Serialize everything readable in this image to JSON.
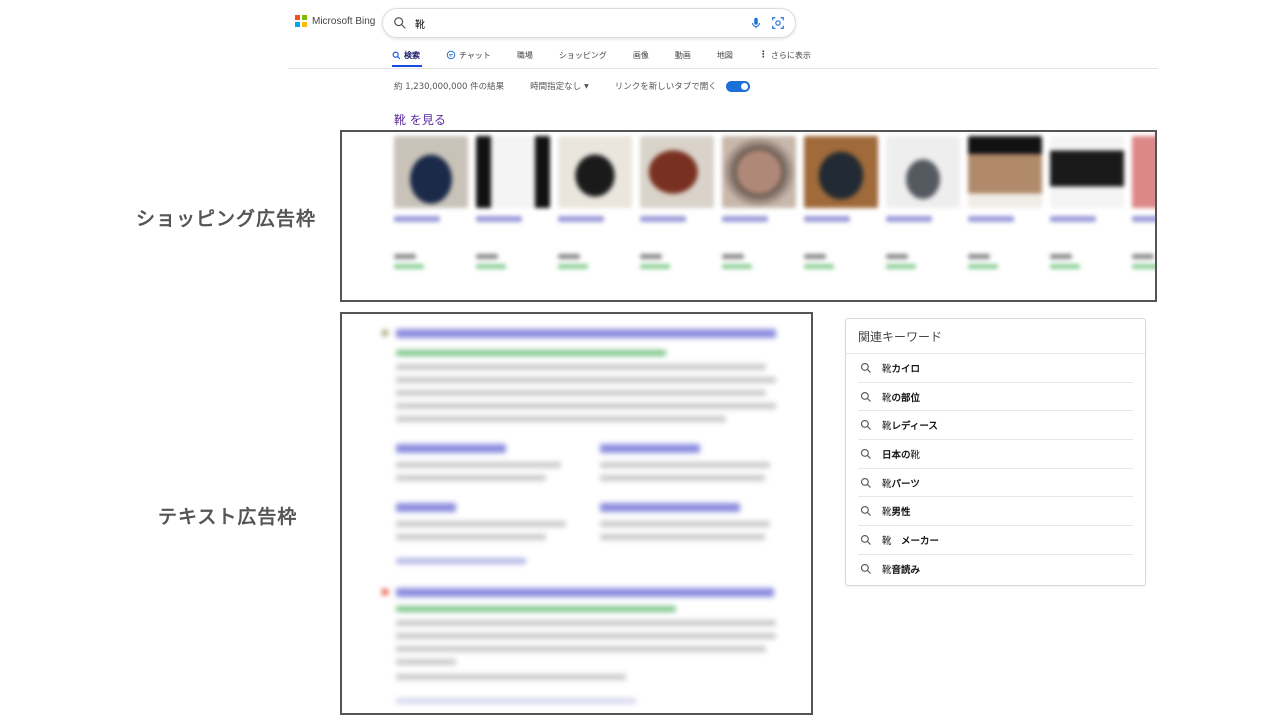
{
  "header": {
    "logo_text": "Microsoft Bing",
    "logo_colors": [
      "#f25022",
      "#7fba00",
      "#00a4ef",
      "#ffb900"
    ],
    "search_value": "靴"
  },
  "tabs": [
    {
      "label": "検索",
      "icon": "search-icon",
      "active": true
    },
    {
      "label": "チャット",
      "icon": "chat-icon",
      "active": false
    },
    {
      "label": "職場",
      "icon": "",
      "active": false
    },
    {
      "label": "ショッピング",
      "icon": "",
      "active": false
    },
    {
      "label": "画像",
      "icon": "",
      "active": false
    },
    {
      "label": "動画",
      "icon": "",
      "active": false
    },
    {
      "label": "地図",
      "icon": "",
      "active": false
    },
    {
      "label": "さらに表示",
      "icon": "more-vertical-icon",
      "active": false
    }
  ],
  "filters": {
    "results_count": "約 1,230,000,000 件の結果",
    "time_filter": "時間指定なし",
    "new_tab_label": "リンクを新しいタブで開く",
    "new_tab_enabled": true
  },
  "see_more": "靴 を見る",
  "annotations": {
    "shopping_label": "ショッピング広告枠",
    "text_ad_label": "テキスト広告枠"
  },
  "related": {
    "title": "関連キーワード",
    "items": [
      {
        "pre": "靴",
        "bold": " カイロ"
      },
      {
        "pre": "靴",
        "bold": "の部位"
      },
      {
        "pre": "靴",
        "bold": " レディース"
      },
      {
        "pre": "",
        "bold": "日本の",
        "post": "靴"
      },
      {
        "pre": "靴",
        "bold": " パーツ"
      },
      {
        "pre": "靴",
        "bold": " 男性"
      },
      {
        "pre": "靴",
        "bold": "　メーカー"
      },
      {
        "pre": "靴",
        "bold": " 音読み"
      }
    ]
  },
  "colors": {
    "accent": "#174ae4",
    "link_purple": "#5b2c9c",
    "toggle_blue": "#1b6fd8"
  }
}
